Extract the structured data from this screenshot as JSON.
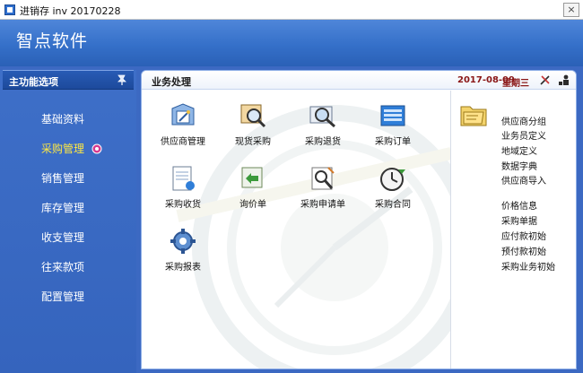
{
  "window": {
    "title": "进销存 inv 20170228",
    "close_glyph": "×"
  },
  "banner": {
    "brand": "智点软件"
  },
  "sidebar": {
    "header": "主功能选项",
    "items": [
      {
        "label": "基础资料"
      },
      {
        "label": "采购管理",
        "active": true
      },
      {
        "label": "销售管理"
      },
      {
        "label": "库存管理"
      },
      {
        "label": "收支管理"
      },
      {
        "label": "往来款项"
      },
      {
        "label": "配置管理"
      }
    ]
  },
  "content": {
    "header": "业务处理",
    "date": "2017-08-09",
    "weekday": "星期三",
    "tiles": [
      {
        "label": "供应商管理",
        "icon": "supplier-icon"
      },
      {
        "label": "现货采购",
        "icon": "spot-purchase-icon"
      },
      {
        "label": "采购退货",
        "icon": "purchase-return-icon"
      },
      {
        "label": "采购订单",
        "icon": "purchase-order-icon"
      },
      {
        "label": "采购收货",
        "icon": "purchase-receipt-icon"
      },
      {
        "label": "询价单",
        "icon": "inquiry-icon"
      },
      {
        "label": "采购申请单",
        "icon": "purchase-request-icon"
      },
      {
        "label": "采购合同",
        "icon": "purchase-contract-icon"
      },
      {
        "label": "采购报表",
        "icon": "purchase-report-icon"
      }
    ]
  },
  "right_panel": {
    "group1": [
      "供应商分组",
      "业务员定义",
      "地域定义",
      "数据字典",
      "供应商导入"
    ],
    "group2": [
      "价格信息",
      "采购单据",
      "应付款初始",
      "预付款初始",
      "采购业务初始"
    ]
  },
  "colors": {
    "accent": "#3a67c0",
    "active_menu": "#ffe843",
    "date": "#8a1616"
  }
}
